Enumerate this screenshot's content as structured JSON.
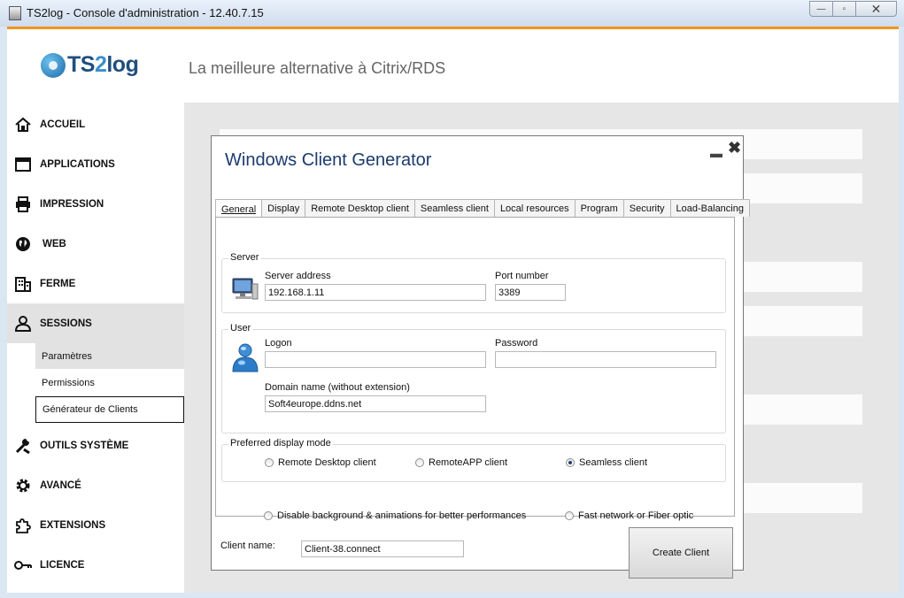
{
  "window": {
    "title": "TS2log - Console d'administration - 12.40.7.15",
    "minimize": "—",
    "maximize": "▫",
    "close": "✕"
  },
  "header": {
    "logo_prefix": "TS",
    "logo_num": "2",
    "logo_suffix": "log",
    "tagline": "La meilleure alternative à Citrix/RDS"
  },
  "sidebar": {
    "items": [
      {
        "label": "ACCUEIL",
        "icon": "home-icon"
      },
      {
        "label": "APPLICATIONS",
        "icon": "window-icon"
      },
      {
        "label": "IMPRESSION",
        "icon": "printer-icon"
      },
      {
        "label": "WEB",
        "icon": "globe-icon"
      },
      {
        "label": "FERME",
        "icon": "building-icon"
      },
      {
        "label": "SESSIONS",
        "icon": "user-icon"
      },
      {
        "label": "OUTILS SYSTÈME",
        "icon": "wrench-icon"
      },
      {
        "label": "AVANCÉ",
        "icon": "gear-icon"
      },
      {
        "label": "EXTENSIONS",
        "icon": "puzzle-icon"
      },
      {
        "label": "LICENCE",
        "icon": "key-icon"
      }
    ],
    "sub_items": [
      "Paramètres",
      "Permissions",
      "Générateur de Clients"
    ]
  },
  "dialog": {
    "title": "Windows Client Generator",
    "minimize": "▬",
    "close": "✖",
    "tabs": [
      "General",
      "Display",
      "Remote Desktop client",
      "Seamless client",
      "Local resources",
      "Program",
      "Security",
      "Load-Balancing"
    ],
    "active_tab": "General",
    "server": {
      "group_label": "Server",
      "address_label": "Server address",
      "address_value": "192.168.1.11",
      "port_label": "Port number",
      "port_value": "3389"
    },
    "user": {
      "group_label": "User",
      "logon_label": "Logon",
      "logon_value": "",
      "password_label": "Password",
      "password_value": "",
      "domain_label": "Domain name (without extension)",
      "domain_value": "Soft4europe.ddns.net"
    },
    "display_mode": {
      "group_label": "Preferred display mode",
      "options": [
        "Remote Desktop client",
        "RemoteAPP client",
        "Seamless client"
      ],
      "selected": "Seamless client"
    },
    "options": {
      "disable_background": "Disable background & animations for better performances",
      "fast_network": "Fast network or Fiber optic"
    },
    "client_name_label": "Client name:",
    "client_name_value": "Client-38.connect",
    "create_button": "Create Client"
  },
  "colors": {
    "accent": "#f0951c",
    "dialog_title": "#1b3b6e",
    "logo_dark": "#1f4f7d",
    "logo_light": "#3b8fcc",
    "selected_nav": "#e2e2e2"
  }
}
